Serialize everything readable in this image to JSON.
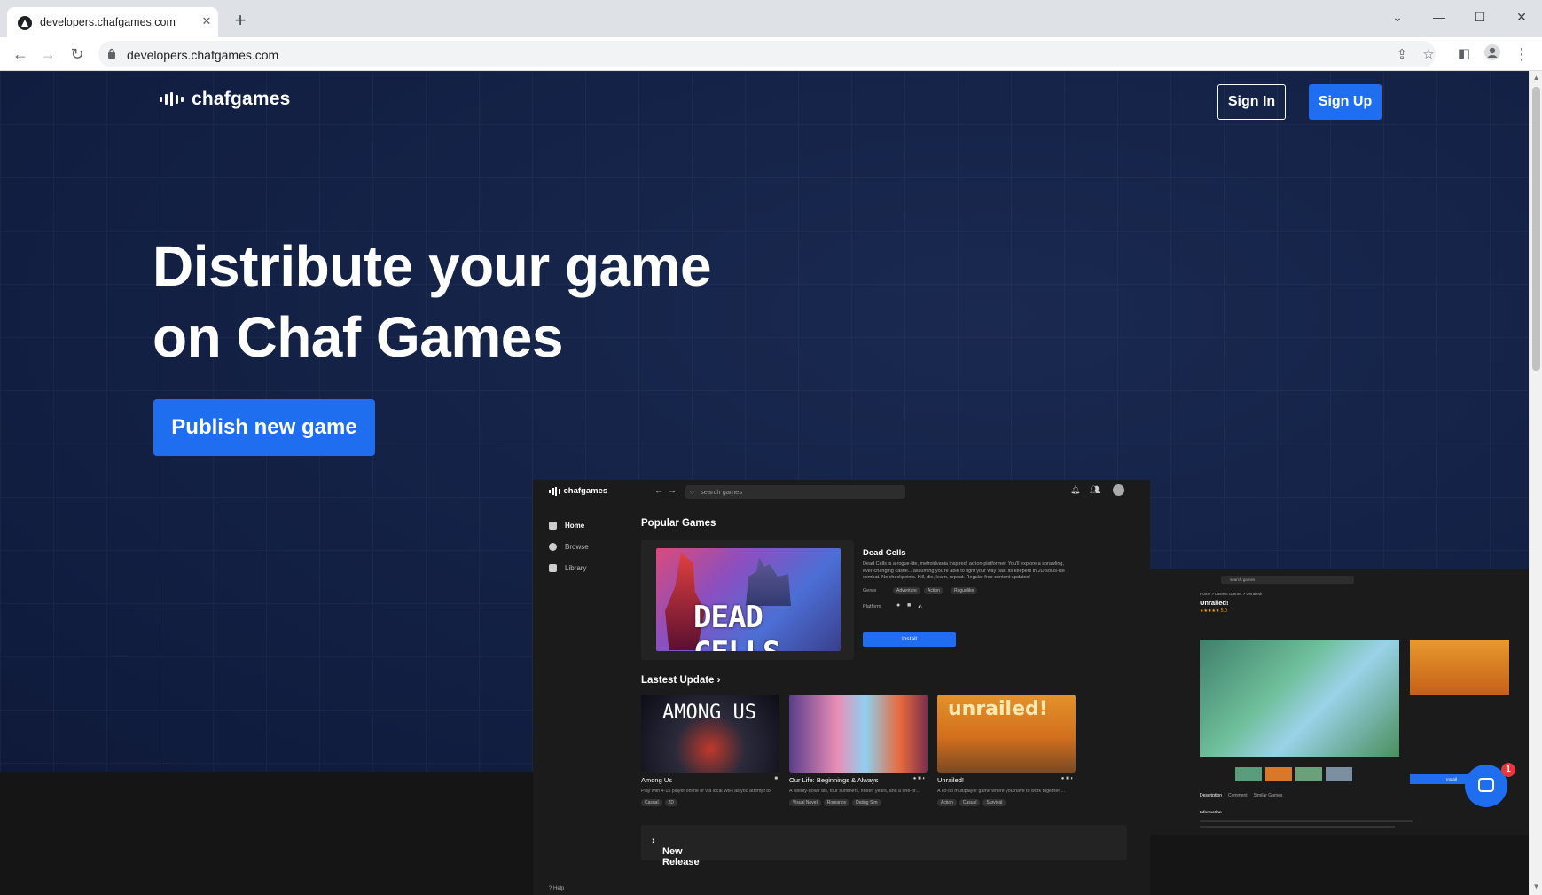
{
  "browser": {
    "tab_title": "developers.chafgames.com",
    "url": "developers.chafgames.com",
    "new_tab_symbol": "+",
    "close_symbol": "✕",
    "window_controls": [
      "⌄",
      "—",
      "☐",
      "✕"
    ]
  },
  "header": {
    "brand": "chafgames",
    "signin_label": "Sign In",
    "signup_label": "Sign Up"
  },
  "hero": {
    "headline_line1": "Distribute your game",
    "headline_line2": "on Chaf Games",
    "cta_label": "Publish new game"
  },
  "mockup": {
    "brand": "chafgames",
    "search_placeholder": "search games",
    "sidebar": [
      {
        "label": "Home",
        "icon": "home-icon"
      },
      {
        "label": "Browse",
        "icon": "compass-icon"
      },
      {
        "label": "Library",
        "icon": "library-icon"
      }
    ],
    "help_label": "Help",
    "popular_heading": "Popular Games",
    "featured": {
      "art_text": "DEAD CELLS",
      "title": "Dead Cells",
      "description": "Dead Cells is a rogue-lite, metroidvania inspired, action-platformer. You'll explore a sprawling, ever-changing castle... assuming you're able to fight your way past its keepers in 2D souls-lite combat. No checkpoints. Kill, die, learn, repeat. Regular free content updates!",
      "genre_label": "Genre",
      "genres": [
        "Adventure",
        "Action",
        "Roguelike"
      ],
      "platform_label": "Platform",
      "install_label": "Install"
    },
    "latest_heading": "Lastest Update",
    "latest": [
      {
        "name": "Among Us",
        "art_text": "AMONG US",
        "desc": "Play with 4-15 player online or via local WiFi as you attempt to",
        "tags": [
          "Casual",
          "2D"
        ],
        "platforms": "■"
      },
      {
        "name": "Our Life: Beginnings & Always",
        "art_text": "",
        "desc": "A twenty-dollar bill, four summers, fifteen years, and a one-of...",
        "tags": [
          "Visual Novel",
          "Romance",
          "Dating Sim"
        ],
        "platforms": "● ■ ◐"
      },
      {
        "name": "Unrailed!",
        "art_text": "unrailed!",
        "desc": "A co-op multiplayer game where you have to work together ...",
        "tags": [
          "Action",
          "Casual",
          "Survival"
        ],
        "platforms": "● ■ ◐"
      }
    ],
    "new_release_heading": "New Release"
  },
  "mockup2": {
    "search_placeholder": "search games",
    "breadcrumb": "Home > Lastest Games > Unrailed!",
    "title": "Unrailed!",
    "rating": "★★★★★ 5.0",
    "install_label": "Install",
    "tabs": [
      "Description",
      "Comment",
      "Similar Games"
    ],
    "info_heading": "Information"
  },
  "chat": {
    "badge_count": "1"
  },
  "colors": {
    "accent": "#1f6ef0",
    "hero_bg": "#142247",
    "dark_band": "#151515"
  }
}
